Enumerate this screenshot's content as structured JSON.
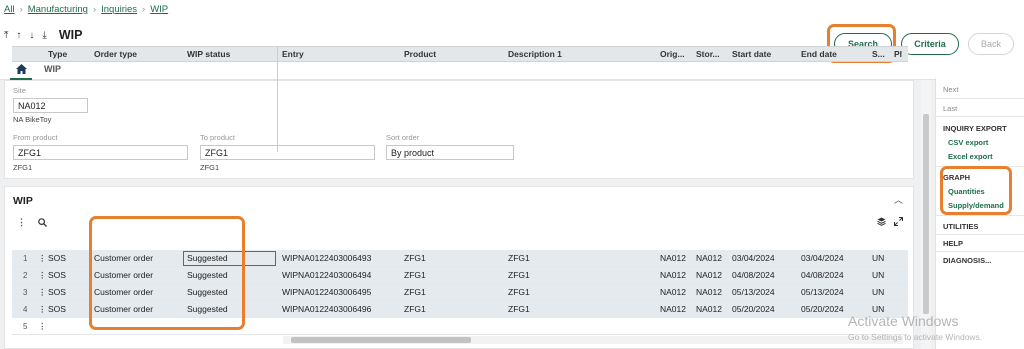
{
  "breadcrumb": [
    "All",
    "Manufacturing",
    "Inquiries",
    "WIP"
  ],
  "title": "WIP",
  "actions": {
    "search": "Search",
    "criteria": "Criteria",
    "back": "Back"
  },
  "tabs": {
    "wip": "WIP"
  },
  "criteria": {
    "site_label": "Site",
    "site_value": "NA012",
    "site_sub": "NA BikeToy",
    "from_label": "From product",
    "from_value": "ZFG1",
    "from_sub": "ZFG1",
    "to_label": "To product",
    "to_value": "ZFG1",
    "to_sub": "ZFG1",
    "sort_label": "Sort order",
    "sort_value": "By product"
  },
  "wip": {
    "title": "WIP",
    "columns": [
      "Type",
      "Order type",
      "WIP status",
      "Entry",
      "Product",
      "Description 1",
      "Orig...",
      "Stor...",
      "Start date",
      "End date",
      "S...",
      "Pl"
    ],
    "rows": [
      {
        "n": "1",
        "type": "SOS",
        "order_type": "Customer order",
        "status": "Suggested",
        "entry": "WIPNA0122403006493",
        "product": "ZFG1",
        "desc": "ZFG1",
        "orig": "NA012",
        "stor": "NA012",
        "start": "03/04/2024",
        "end": "03/04/2024",
        "s": "UN"
      },
      {
        "n": "2",
        "type": "SOS",
        "order_type": "Customer order",
        "status": "Suggested",
        "entry": "WIPNA0122403006494",
        "product": "ZFG1",
        "desc": "ZFG1",
        "orig": "NA012",
        "stor": "NA012",
        "start": "04/08/2024",
        "end": "04/08/2024",
        "s": "UN"
      },
      {
        "n": "3",
        "type": "SOS",
        "order_type": "Customer order",
        "status": "Suggested",
        "entry": "WIPNA0122403006495",
        "product": "ZFG1",
        "desc": "ZFG1",
        "orig": "NA012",
        "stor": "NA012",
        "start": "05/13/2024",
        "end": "05/13/2024",
        "s": "UN"
      },
      {
        "n": "4",
        "type": "SOS",
        "order_type": "Customer order",
        "status": "Suggested",
        "entry": "WIPNA0122403006496",
        "product": "ZFG1",
        "desc": "ZFG1",
        "orig": "NA012",
        "stor": "NA012",
        "start": "05/20/2024",
        "end": "05/20/2024",
        "s": "UN"
      }
    ],
    "empty_row_n": "5"
  },
  "side": {
    "next": "Next",
    "last": "Last",
    "inquiry_export": "INQUIRY EXPORT",
    "csv": "CSV export",
    "excel": "Excel export",
    "graph": "GRAPH",
    "quantities": "Quantities",
    "supply": "Supply/demand",
    "utilities": "UTILITIES",
    "help": "HELP",
    "diagnosis": "DIAGNOSIS..."
  },
  "watermark": {
    "title": "Activate Windows",
    "sub": "Go to Settings to activate Windows."
  },
  "colors": {
    "accent": "#1e6e4a",
    "highlight": "#e87f2e"
  }
}
